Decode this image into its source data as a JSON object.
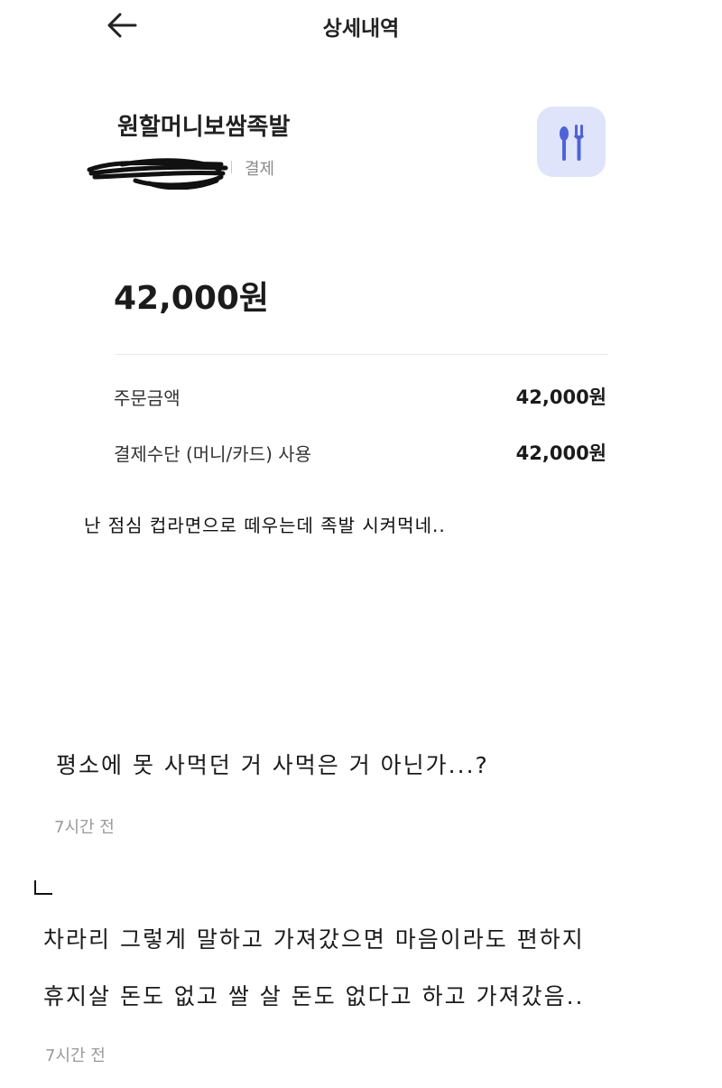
{
  "header": {
    "title": "상세내역",
    "back_icon": "arrow-left-icon"
  },
  "merchant": {
    "name": "원할머니보쌈족발",
    "pay_label": "결제",
    "category_icon": "fork-spoon-icon",
    "icon_bg": "#dfe4fb",
    "icon_color": "#4f63d8"
  },
  "amount": {
    "total": "42,000원"
  },
  "details": [
    {
      "label": "주문금액",
      "value": "42,000원"
    },
    {
      "label": "결제수단 (머니/카드) 사용",
      "value": "42,000원"
    }
  ],
  "caption": "난 점심 컵라면으로 떼우는데 족발 시켜먹네..",
  "comments": [
    {
      "text_lines": [
        "평소에 못 사먹던 거 사먹은 거 아닌가...?"
      ],
      "time": "7시간 전"
    },
    {
      "reply_icon": "reply-arrow-icon",
      "text_lines": [
        "차라리 그렇게 말하고 가져갔으면 마음이라도 편하지",
        "휴지살 돈도 없고 쌀 살 돈도 없다고 하고 가져갔음.."
      ],
      "time": "7시간 전"
    }
  ]
}
